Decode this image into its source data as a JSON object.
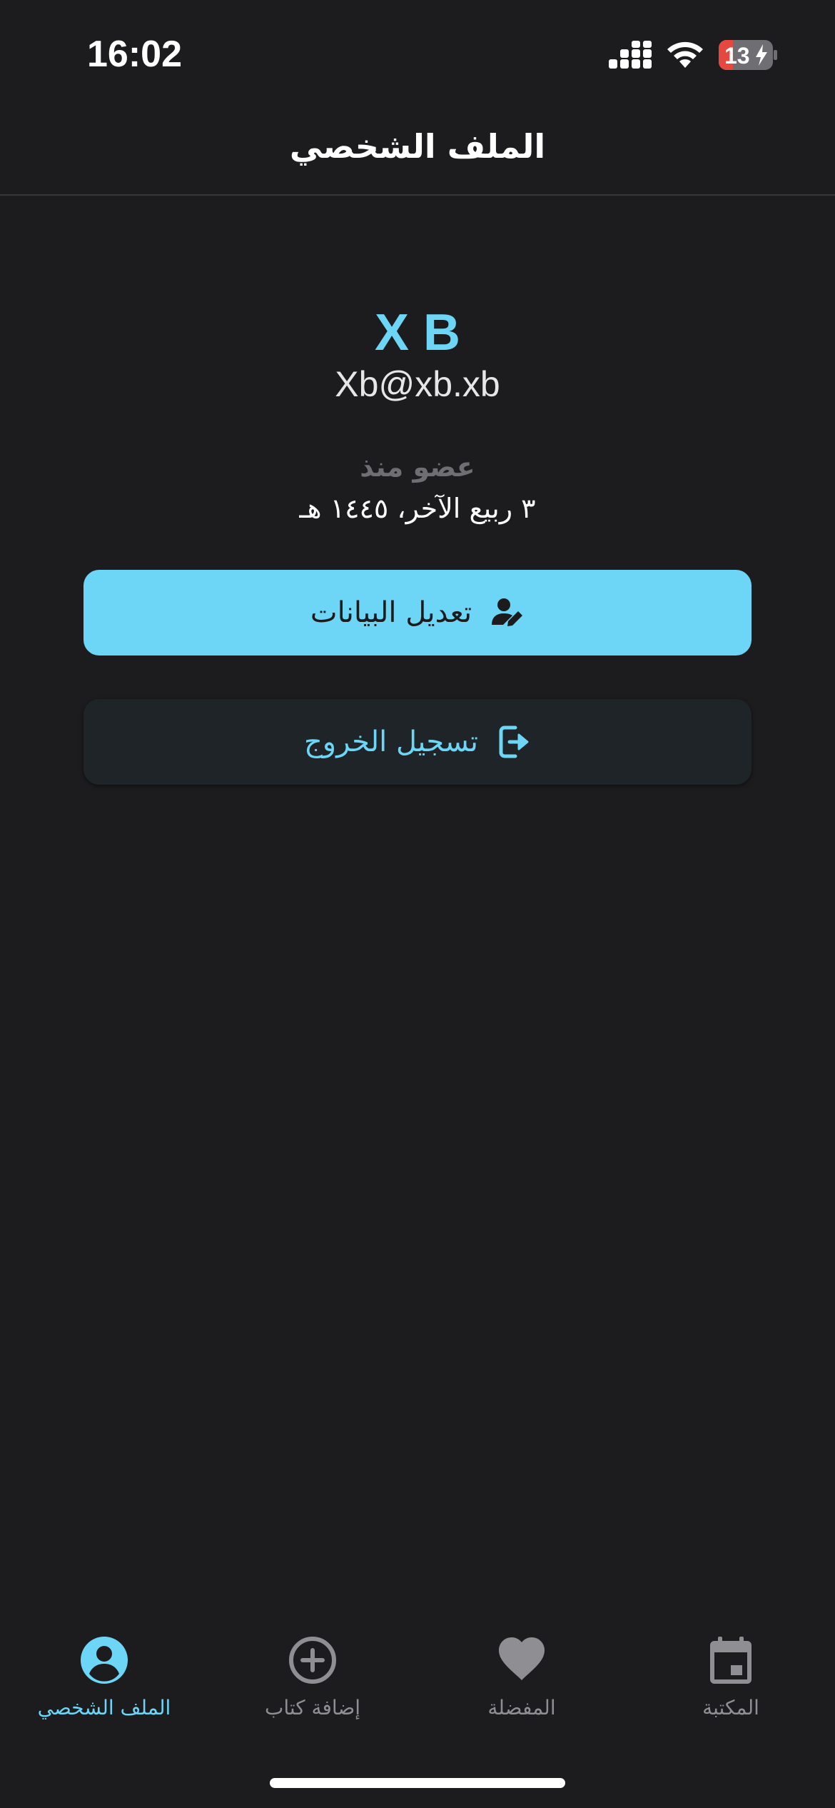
{
  "status_bar": {
    "time": "16:02",
    "battery": "13"
  },
  "header": {
    "title": "الملف الشخصي"
  },
  "profile": {
    "name": "X B",
    "email": "Xb@xb.xb",
    "member_since_label": "عضو منذ",
    "member_since_date": "٣ ربيع الآخر، ١٤٤٥ هـ"
  },
  "actions": {
    "edit_label": "تعديل البيانات",
    "logout_label": "تسجيل الخروج"
  },
  "tab_bar": {
    "tabs": [
      {
        "label": "الملف الشخصي",
        "icon": "account-circle-icon",
        "active": true
      },
      {
        "label": "إضافة كتاب",
        "icon": "add-circle-icon",
        "active": false
      },
      {
        "label": "المفضلة",
        "icon": "heart-icon",
        "active": false
      },
      {
        "label": "المكتبة",
        "icon": "calendar-icon",
        "active": false
      }
    ]
  },
  "colors": {
    "background": "#1c1c1e",
    "accent": "#6dd5f5",
    "inactive": "#8e8e93",
    "battery_low": "#e5483f"
  }
}
